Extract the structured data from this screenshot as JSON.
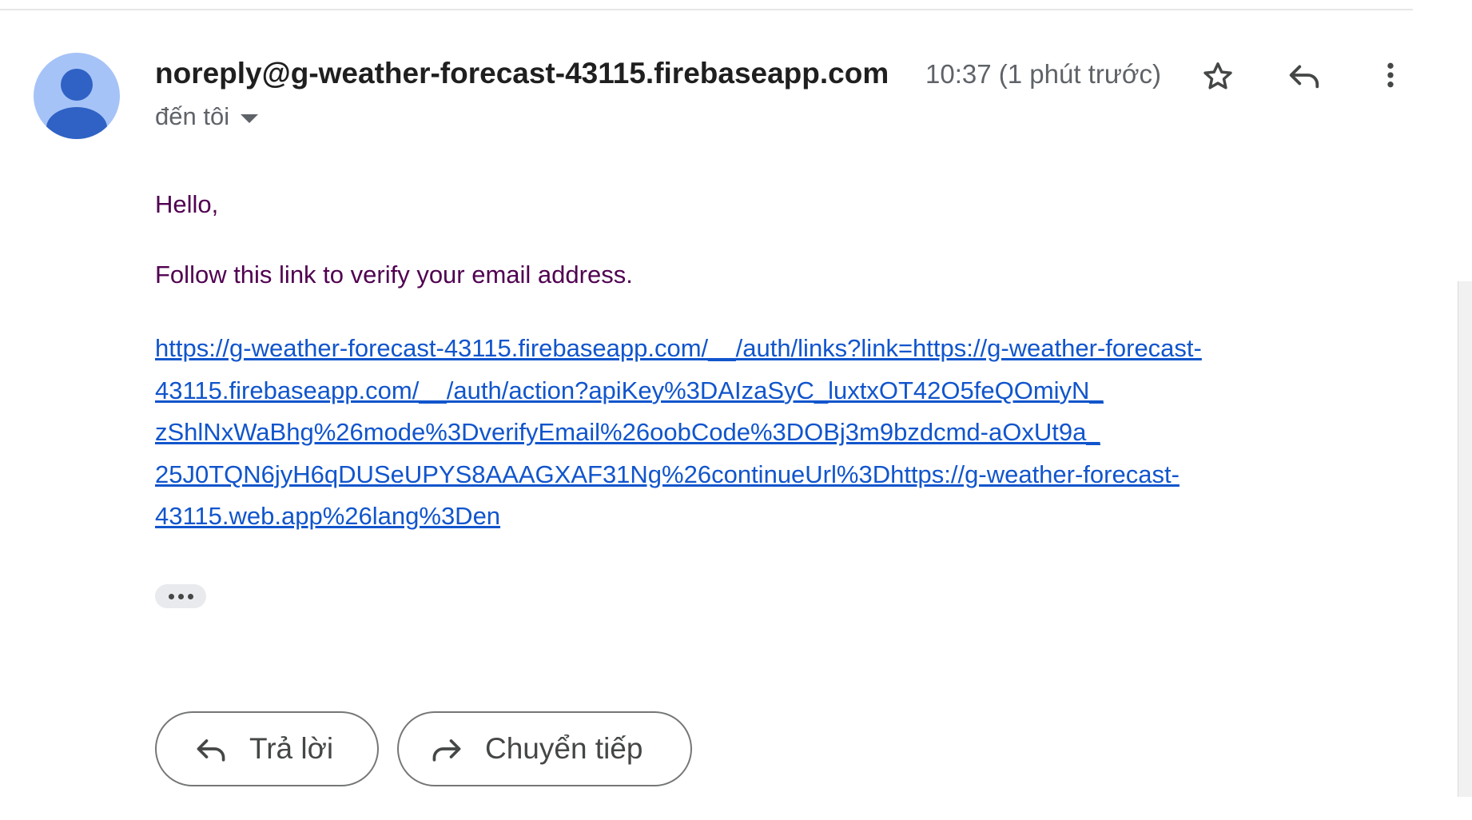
{
  "header": {
    "sender": "noreply@g-weather-forecast-43115.firebaseapp.com",
    "recipient_label": "đến tôi",
    "timestamp": "10:37 (1 phút trước)",
    "icons": {
      "avatar": "person-avatar-icon",
      "star": "star-icon",
      "reply": "reply-icon",
      "more": "more-vert-icon",
      "caret": "caret-down-icon"
    }
  },
  "message": {
    "greeting": "Hello,",
    "instruction": "Follow this link to verify your email address.",
    "link_lines": [
      "https://g-weather-forecast-43115.firebaseapp.com/__/auth/links?link=https://g-weather-forecast-",
      "43115.firebaseapp.com/__/auth/action?apiKey%3DAIzaSyC_luxtxOT42O5feQOmiyN_",
      "zShlNxWaBhg%26mode%3DverifyEmail%26oobCode%3DOBj3m9bzdcmd-aOxUt9a_",
      "25J0TQN6jyH6qDUSeUPYS8AAAGXAF31Ng%26continueUrl%3Dhttps://g-weather-forecast-",
      "43115.web.app%26lang%3Den"
    ],
    "trimmed_content_icon": "more-horiz-icon"
  },
  "actions": {
    "reply_label": "Trả lời",
    "forward_label": "Chuyển tiếp",
    "reply_icon": "reply-icon",
    "forward_icon": "forward-icon"
  },
  "colors": {
    "avatar_bg": "#a6c3f8",
    "avatar_fg": "#2f62c4",
    "body_text": "#500050",
    "link": "#1155cc"
  }
}
